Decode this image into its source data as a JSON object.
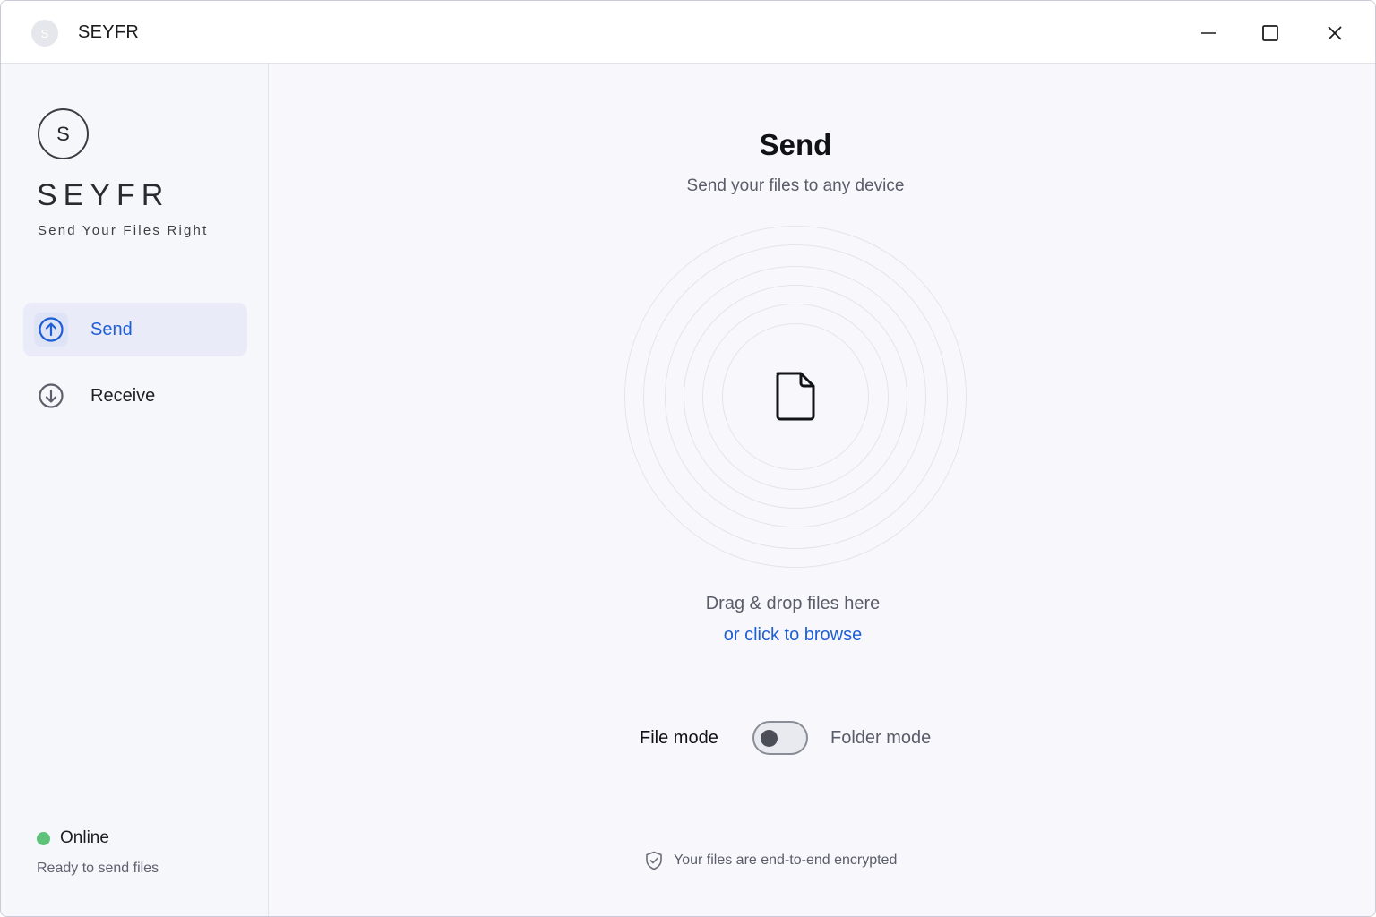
{
  "window": {
    "title": "SEYFR",
    "app_icon_letter": "S",
    "controls": [
      "minimize-icon",
      "maximize-icon",
      "close-icon"
    ]
  },
  "sidebar": {
    "logo_letter": "S",
    "brand_name": "SEYFR",
    "tagline": "Send Your Files Right",
    "items": [
      {
        "label": "Send",
        "icon": "arrow-up-circle-icon",
        "active": true
      },
      {
        "label": "Receive",
        "icon": "arrow-down-circle-icon",
        "active": false
      }
    ],
    "status": {
      "label": "Online",
      "detail": "Ready to send files",
      "color": "#5ec27a"
    }
  },
  "main": {
    "title": "Send",
    "subtitle": "Send your files to any device",
    "dropzone": {
      "icon": "file-icon",
      "drag_text": "Drag & drop files here",
      "browse_text": "or click to browse"
    },
    "mode_toggle": {
      "left_label": "File mode",
      "right_label": "Folder mode",
      "folder_mode_on": false
    },
    "footer_note": {
      "icon": "shield-check-icon",
      "text": "Your files are end-to-end encrypted"
    }
  },
  "colors": {
    "accent": "#1f5fd6",
    "active_nav_bg": "#e9ebf8",
    "online": "#5ec27a"
  }
}
